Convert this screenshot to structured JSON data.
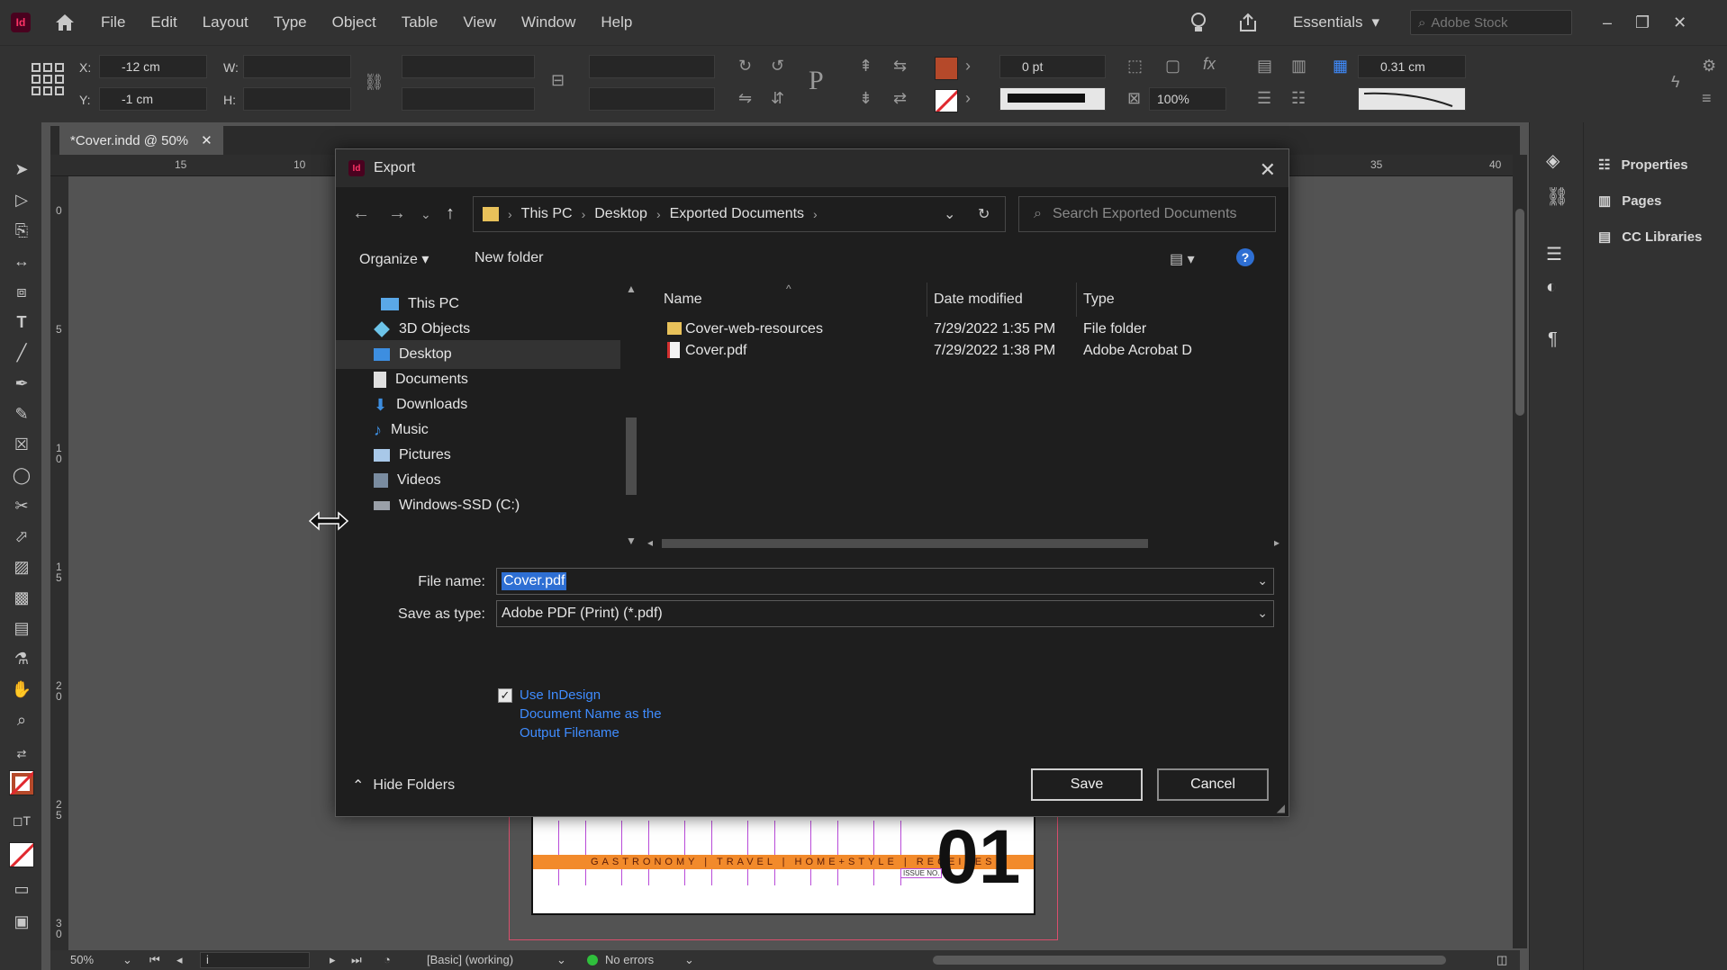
{
  "menubar": {
    "app_logo": "Id",
    "items": [
      "File",
      "Edit",
      "Layout",
      "Type",
      "Object",
      "Table",
      "View",
      "Window",
      "Help"
    ],
    "workspace": "Essentials",
    "stock_placeholder": "Adobe Stock"
  },
  "controlbar": {
    "x_label": "X:",
    "x_value": "-12 cm",
    "y_label": "Y:",
    "y_value": "-1 cm",
    "w_label": "W:",
    "h_label": "H:",
    "stroke_weight": "0 pt",
    "opacity": "100%",
    "gutter": "0.31 cm",
    "fill_color": "#b5492a"
  },
  "document": {
    "tab_title": "*Cover.indd @ 50%",
    "ruler_top": [
      "15",
      "10",
      "35",
      "40"
    ],
    "ruler_left": [
      "0",
      "5",
      "10",
      "15",
      "20",
      "25",
      "30"
    ],
    "band_text": "GASTRONOMY | TRAVEL | HOME+STYLE | RECEIPES",
    "issue_label": "ISSUE NO.",
    "big_number": "01"
  },
  "statusbar": {
    "zoom": "50%",
    "page": "i",
    "preflight_profile": "[Basic] (working)",
    "errors": "No errors"
  },
  "panels": {
    "items": [
      "Properties",
      "Pages",
      "CC Libraries"
    ]
  },
  "dialog": {
    "title": "Export",
    "breadcrumb": [
      "This PC",
      "Desktop",
      "Exported Documents"
    ],
    "search_placeholder": "Search Exported Documents",
    "organize": "Organize",
    "new_folder": "New folder",
    "nav": [
      {
        "label": "This PC",
        "icon": "computer-icon"
      },
      {
        "label": "3D Objects",
        "icon": "cube-icon"
      },
      {
        "label": "Desktop",
        "icon": "desktop-icon"
      },
      {
        "label": "Documents",
        "icon": "document-icon"
      },
      {
        "label": "Downloads",
        "icon": "download-icon"
      },
      {
        "label": "Music",
        "icon": "music-icon"
      },
      {
        "label": "Pictures",
        "icon": "pictures-icon"
      },
      {
        "label": "Videos",
        "icon": "video-icon"
      },
      {
        "label": "Windows-SSD (C:)",
        "icon": "drive-icon"
      }
    ],
    "columns": [
      "Name",
      "Date modified",
      "Type"
    ],
    "files": [
      {
        "name": "Cover-web-resources",
        "date": "7/29/2022 1:35 PM",
        "type": "File folder",
        "icon": "folder-icon"
      },
      {
        "name": "Cover.pdf",
        "date": "7/29/2022 1:38 PM",
        "type": "Adobe Acrobat D",
        "icon": "pdf-icon"
      }
    ],
    "file_name_label": "File name:",
    "file_name_value": "Cover.pdf",
    "save_type_label": "Save as type:",
    "save_type_value": "Adobe PDF (Print) (*.pdf)",
    "checkbox_label": "Use InDesign Document Name as the Output Filename",
    "checkbox_checked": true,
    "hide_folders": "Hide Folders",
    "save": "Save",
    "cancel": "Cancel"
  },
  "colors": {
    "accent_blue": "#2e6fd3",
    "link_blue": "#3f8cff",
    "indesign_pink": "#ff3366",
    "band_orange": "#f28a2b"
  }
}
